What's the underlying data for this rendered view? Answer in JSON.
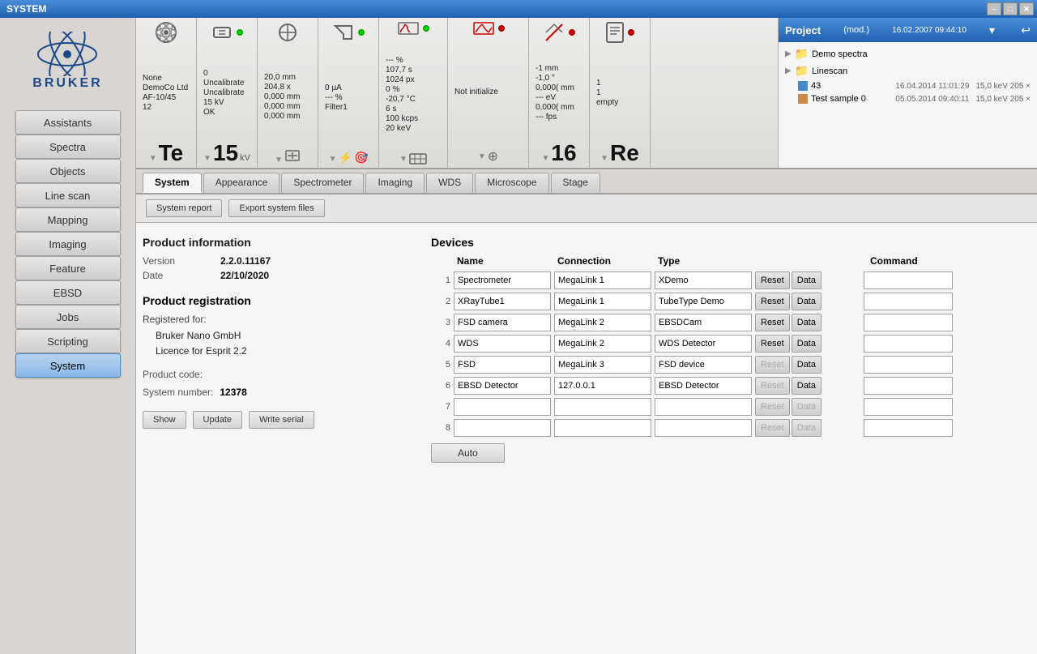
{
  "titleBar": {
    "title": "SYSTEM"
  },
  "sidebar": {
    "buttons": [
      {
        "id": "assistants",
        "label": "Assistants",
        "active": false
      },
      {
        "id": "spectra",
        "label": "Spectra",
        "active": false
      },
      {
        "id": "objects",
        "label": "Objects",
        "active": false
      },
      {
        "id": "linescan",
        "label": "Line scan",
        "active": false
      },
      {
        "id": "mapping",
        "label": "Mapping",
        "active": false
      },
      {
        "id": "imaging",
        "label": "Imaging",
        "active": false
      },
      {
        "id": "feature",
        "label": "Feature",
        "active": false
      },
      {
        "id": "ebsd",
        "label": "EBSD",
        "active": false
      },
      {
        "id": "jobs",
        "label": "Jobs",
        "active": false
      },
      {
        "id": "scripting",
        "label": "Scripting",
        "active": false
      },
      {
        "id": "system",
        "label": "System",
        "active": true
      }
    ]
  },
  "toolbar": {
    "sections": [
      {
        "id": "electron",
        "topLines": [
          "None",
          "DemoCo Ltd",
          "AF-10/45",
          "12"
        ],
        "bigNum": "Te",
        "unit": ""
      },
      {
        "id": "voltage",
        "topLines": [
          "0",
          "Uncalibrate",
          "Uncalibrate",
          "15 kV",
          "OK"
        ],
        "bigNum": "15",
        "unit": ""
      },
      {
        "id": "current",
        "topLines": [
          "20,0 mm",
          "204,8 x",
          "0,000 mm",
          "0,000 mm",
          "0,000 mm"
        ],
        "bigNum": "",
        "unit": ""
      },
      {
        "id": "filter",
        "topLines": [
          "0 µA",
          "---  %",
          "Filter1"
        ],
        "bigNum": "",
        "unit": ""
      },
      {
        "id": "scan",
        "topLines": [
          "--- %",
          "107,7 s",
          "1024 px",
          "0 %",
          "-20,7 °C",
          "6 s",
          "100 kcps",
          "20 keV"
        ],
        "bigNum": "",
        "unit": ""
      },
      {
        "id": "spectrum",
        "topLines": [
          "Not initialize"
        ],
        "bigNum": "",
        "unit": ""
      },
      {
        "id": "wds",
        "topLines": [
          "-1 mm",
          "-1,0 °",
          "0,000( mm",
          "--- eV",
          "0,000( mm",
          "--- fps"
        ],
        "bigNum": "16",
        "unit": ""
      },
      {
        "id": "report",
        "topLines": [
          "1",
          "1",
          "empty"
        ],
        "bigNum": "Re",
        "unit": ""
      }
    ]
  },
  "rightPanel": {
    "projectTitle": "Project",
    "modifiedLabel": "(mod.)",
    "dateTime": "16.02.2007 09:44:10",
    "treeItems": [
      {
        "id": "demo-spectra",
        "label": "Demo spectra",
        "type": "folder",
        "indent": 1
      },
      {
        "id": "linescan",
        "label": "Linescan",
        "type": "folder",
        "indent": 1
      },
      {
        "id": "entry-43",
        "label": "43",
        "date": "16.04.2014 11:01:29",
        "meta": "15,0 keV 205 ×",
        "type": "item",
        "indent": 2
      },
      {
        "id": "test-sample",
        "label": "Test sample 0",
        "date": "05.05.2014 09:40:11",
        "meta": "15,0 keV 205 ×",
        "type": "item",
        "indent": 2
      }
    ]
  },
  "tabs": [
    {
      "id": "system",
      "label": "System",
      "active": true
    },
    {
      "id": "appearance",
      "label": "Appearance",
      "active": false
    },
    {
      "id": "spectrometer",
      "label": "Spectrometer",
      "active": false
    },
    {
      "id": "imaging",
      "label": "Imaging",
      "active": false
    },
    {
      "id": "wds",
      "label": "WDS",
      "active": false
    },
    {
      "id": "microscope",
      "label": "Microscope",
      "active": false
    },
    {
      "id": "stage",
      "label": "Stage",
      "active": false
    }
  ],
  "actionBar": {
    "reportBtn": "System report",
    "exportBtn": "Export system files"
  },
  "productInfo": {
    "title": "Product information",
    "version": {
      "label": "Version",
      "value": "2.2.0.11167"
    },
    "date": {
      "label": "Date",
      "value": "22/10/2020"
    }
  },
  "registration": {
    "title": "Product registration",
    "registeredFor": "Registered for:",
    "company": "Bruker Nano GmbH",
    "license": "Licence for Esprit 2.2",
    "productCode": {
      "label": "Product code:",
      "value": ""
    },
    "systemNumber": {
      "label": "System number:",
      "value": "12378"
    },
    "showBtn": "Show",
    "updateBtn": "Update",
    "writeSerialBtn": "Write serial"
  },
  "devices": {
    "title": "Devices",
    "headers": [
      "",
      "Name",
      "Connection",
      "Type",
      "",
      "",
      "Command"
    ],
    "rows": [
      {
        "num": "1",
        "name": "Spectrometer",
        "connection": "MegaLink 1",
        "type": "XDemo",
        "resetDisabled": false,
        "dataDisabled": false
      },
      {
        "num": "2",
        "name": "XRayTube1",
        "connection": "MegaLink 1",
        "type": "TubeType Demo",
        "resetDisabled": false,
        "dataDisabled": false
      },
      {
        "num": "3",
        "name": "FSD camera",
        "connection": "MegaLink 2",
        "type": "EBSDCam",
        "resetDisabled": false,
        "dataDisabled": false
      },
      {
        "num": "4",
        "name": "WDS",
        "connection": "MegaLink 2",
        "type": "WDS Detector",
        "resetDisabled": false,
        "dataDisabled": false
      },
      {
        "num": "5",
        "name": "FSD",
        "connection": "MegaLink 3",
        "type": "FSD device",
        "resetDisabled": true,
        "dataDisabled": false
      },
      {
        "num": "6",
        "name": "EBSD Detector",
        "connection": "127.0.0.1",
        "type": "EBSD Detector",
        "resetDisabled": true,
        "dataDisabled": false
      },
      {
        "num": "7",
        "name": "",
        "connection": "",
        "type": "",
        "resetDisabled": true,
        "dataDisabled": true
      },
      {
        "num": "8",
        "name": "",
        "connection": "",
        "type": "",
        "resetDisabled": true,
        "dataDisabled": true
      }
    ],
    "autoBtn": "Auto"
  }
}
